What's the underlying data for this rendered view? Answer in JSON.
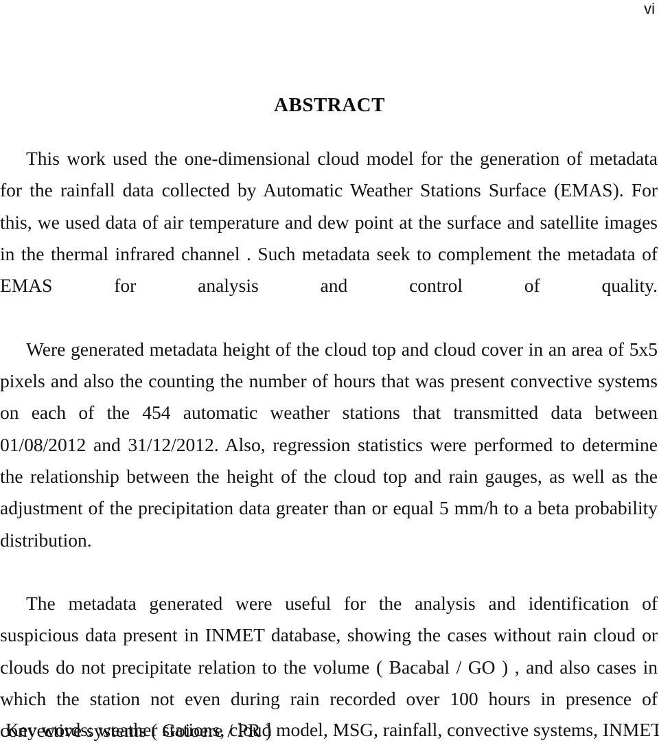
{
  "page": {
    "page_number": "vi",
    "title": "ABSTRACT"
  },
  "abstract": {
    "paragraphs": [
      "This work used the one-dimensional cloud model for the generation of metadata for the rainfall data collected by Automatic Weather Stations Surface (EMAS). For this, we used data of air temperature and dew point at the surface and satellite images in the thermal infrared channel . Such metadata seek to complement the metadata of EMAS for analysis and control of quality.",
      "Were generated metadata height of the cloud top and cloud cover in an area of 5x5 pixels and also the counting the number of hours that was present convective systems on each of the 454 automatic weather stations that transmitted data between 01/08/2012 and 31/12/2012. Also, regression statistics were performed to determine the relationship between the height of the cloud top and rain gauges, as well as the adjustment of the precipitation data greater than or equal 5 mm/h to a beta probability distribution.",
      "The metadata generated were useful for the analysis and identification of suspicious data present in INMET database, showing the cases without rain cloud or clouds do not precipitate relation to the volume ( Bacabal / GO ) , and also cases in which the station not even during rain recorded over 100 hours in presence of convective systems ( Goioere / PR )"
    ]
  },
  "keywords": {
    "line": "Key words: weather stations, cloud model, MSG, rainfall, convective systems, INMET"
  }
}
